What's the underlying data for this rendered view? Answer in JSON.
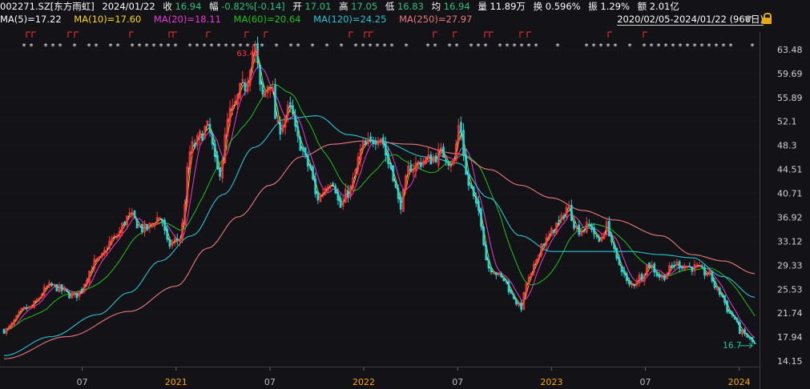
{
  "header": {
    "code": "002271.SZ[东方雨虹]",
    "date": "2024/01/22",
    "close_label": "收",
    "close": "16.94",
    "change_label": "幅",
    "change": "-0.82%[-0.14]",
    "open_label": "开",
    "open": "17.01",
    "high_label": "高",
    "high": "17.05",
    "low_label": "低",
    "low": "16.83",
    "avg_label": "均",
    "avg": "16.94",
    "volume_label": "量",
    "volume": "11.89万",
    "turnover_label": "换",
    "turnover": "0.596%",
    "amplitude_label": "振",
    "amplitude": "1.29%",
    "amount_label": "额",
    "amount": "2.01亿",
    "range": "2020/02/05-2024/01/22 (966日)"
  },
  "ma_legend": [
    {
      "text": "MA(5)=17.22",
      "color": "#ffffff"
    },
    {
      "text": "MA(10)=17.60",
      "color": "#ffd800"
    },
    {
      "text": "MA(20)=18.11",
      "color": "#e83ad8"
    },
    {
      "text": "MA(60)=20.64",
      "color": "#1fc21f"
    },
    {
      "text": "MA(120)=24.25",
      "color": "#29c4d6"
    },
    {
      "text": "MA(250)=27.97",
      "color": "#e97a7a"
    }
  ],
  "colors": {
    "up": "#ff3535",
    "down": "#1fd6d6",
    "header_up": "#ff4b4b",
    "header_down": "#2ec27e",
    "axis_text": "#d0d0d0",
    "grid": "#2a2a33",
    "year_label": "#ffa500",
    "month_label": "#bbbbbb",
    "peak_label": "#ff3b3b",
    "last_label": "#1fc79a"
  },
  "annotations": {
    "peak": "63.48",
    "last": "16.7"
  },
  "chart_data": {
    "type": "candlestick",
    "ylim": [
      13.0,
      65.5
    ],
    "y_ticks": [
      "63.48",
      "59.69",
      "55.89",
      "52.1",
      "48.3",
      "44.51",
      "40.71",
      "36.92",
      "33.12",
      "29.33",
      "25.53",
      "21.74",
      "17.94",
      "14.15"
    ],
    "x_ticks": [
      {
        "label": "07",
        "month": 5,
        "year": false
      },
      {
        "label": "2021",
        "month": 11,
        "year": true
      },
      {
        "label": "07",
        "month": 17,
        "year": false
      },
      {
        "label": "2022",
        "month": 23,
        "year": true
      },
      {
        "label": "07",
        "month": 29,
        "year": false
      },
      {
        "label": "2023",
        "month": 35,
        "year": true
      },
      {
        "label": "07",
        "month": 41,
        "year": false
      },
      {
        "label": "2024",
        "month": 47,
        "year": true
      }
    ],
    "price_keypoints": [
      [
        0,
        19.0
      ],
      [
        1.5,
        22.5
      ],
      [
        3,
        26.0
      ],
      [
        4.5,
        24.5
      ],
      [
        6,
        30.0
      ],
      [
        7,
        33.5
      ],
      [
        8,
        37.0
      ],
      [
        9,
        35.0
      ],
      [
        10,
        37.0
      ],
      [
        10.5,
        32.5
      ],
      [
        11.2,
        33.5
      ],
      [
        12,
        48.0
      ],
      [
        13,
        51.0
      ],
      [
        13.7,
        44.0
      ],
      [
        14.5,
        53.5
      ],
      [
        15.3,
        57.5
      ],
      [
        16.0,
        63.48
      ],
      [
        16.5,
        56.0
      ],
      [
        17.0,
        58.5
      ],
      [
        17.5,
        51.0
      ],
      [
        18.3,
        54.0
      ],
      [
        18.8,
        49.0
      ],
      [
        19.5,
        45.0
      ],
      [
        20.0,
        40.0
      ],
      [
        21.0,
        43.0
      ],
      [
        21.5,
        38.5
      ],
      [
        22.0,
        41.0
      ],
      [
        23.0,
        48.0
      ],
      [
        24.0,
        50.0
      ],
      [
        24.7,
        45.0
      ],
      [
        25.3,
        39.0
      ],
      [
        26.0,
        45.0
      ],
      [
        27.0,
        46.0
      ],
      [
        28.0,
        47.0
      ],
      [
        28.7,
        45.5
      ],
      [
        29.1,
        51.5
      ],
      [
        29.7,
        42.0
      ],
      [
        30.3,
        38.0
      ],
      [
        31.0,
        29.0
      ],
      [
        32.0,
        27.0
      ],
      [
        32.5,
        24.5
      ],
      [
        33.0,
        22.5
      ],
      [
        33.5,
        27.0
      ],
      [
        34.5,
        33.0
      ],
      [
        35.5,
        36.0
      ],
      [
        36.0,
        38.5
      ],
      [
        36.7,
        35.0
      ],
      [
        37.5,
        35.5
      ],
      [
        38.0,
        33.0
      ],
      [
        38.5,
        35.5
      ],
      [
        39.3,
        29.5
      ],
      [
        40.0,
        26.0
      ],
      [
        40.7,
        27.5
      ],
      [
        41.2,
        29.5
      ],
      [
        42.0,
        27.5
      ],
      [
        43.0,
        29.5
      ],
      [
        44.0,
        29.0
      ],
      [
        45.0,
        28.0
      ],
      [
        45.7,
        25.0
      ],
      [
        46.5,
        21.5
      ],
      [
        47.2,
        18.5
      ],
      [
        48.0,
        17.0
      ]
    ],
    "ma_final": {
      "MA5": 17.22,
      "MA10": 17.6,
      "MA20": 18.11,
      "MA60": 20.64,
      "MA120": 24.25,
      "MA250": 27.97
    },
    "ma250_keypoints": [
      [
        0,
        14.5
      ],
      [
        4,
        18.0
      ],
      [
        8,
        22.0
      ],
      [
        11,
        26.0
      ],
      [
        13,
        32.0
      ],
      [
        15,
        37.0
      ],
      [
        17,
        42.0
      ],
      [
        19,
        46.5
      ],
      [
        21,
        48.5
      ],
      [
        23,
        49.0
      ],
      [
        26,
        48.5
      ],
      [
        29,
        47.0
      ],
      [
        31,
        44.5
      ],
      [
        33,
        42.0
      ],
      [
        35,
        40.0
      ],
      [
        37,
        38.0
      ],
      [
        39,
        36.5
      ],
      [
        42,
        34.0
      ],
      [
        44,
        31.0
      ],
      [
        46,
        30.0
      ],
      [
        48,
        28.0
      ]
    ],
    "ma120_keypoints": [
      [
        0,
        15.0
      ],
      [
        3,
        18.0
      ],
      [
        6,
        21.5
      ],
      [
        8,
        25.0
      ],
      [
        10,
        30.0
      ],
      [
        12,
        34.0
      ],
      [
        14,
        40.5
      ],
      [
        16,
        48.0
      ],
      [
        18,
        52.5
      ],
      [
        20,
        53.0
      ],
      [
        22,
        50.0
      ],
      [
        24,
        49.0
      ],
      [
        27,
        46.5
      ],
      [
        29,
        45.5
      ],
      [
        31,
        40.0
      ],
      [
        33,
        34.0
      ],
      [
        35,
        31.5
      ],
      [
        37,
        31.5
      ],
      [
        40,
        31.5
      ],
      [
        42,
        31.0
      ],
      [
        44,
        30.5
      ],
      [
        46,
        27.5
      ],
      [
        48,
        24.25
      ]
    ]
  }
}
